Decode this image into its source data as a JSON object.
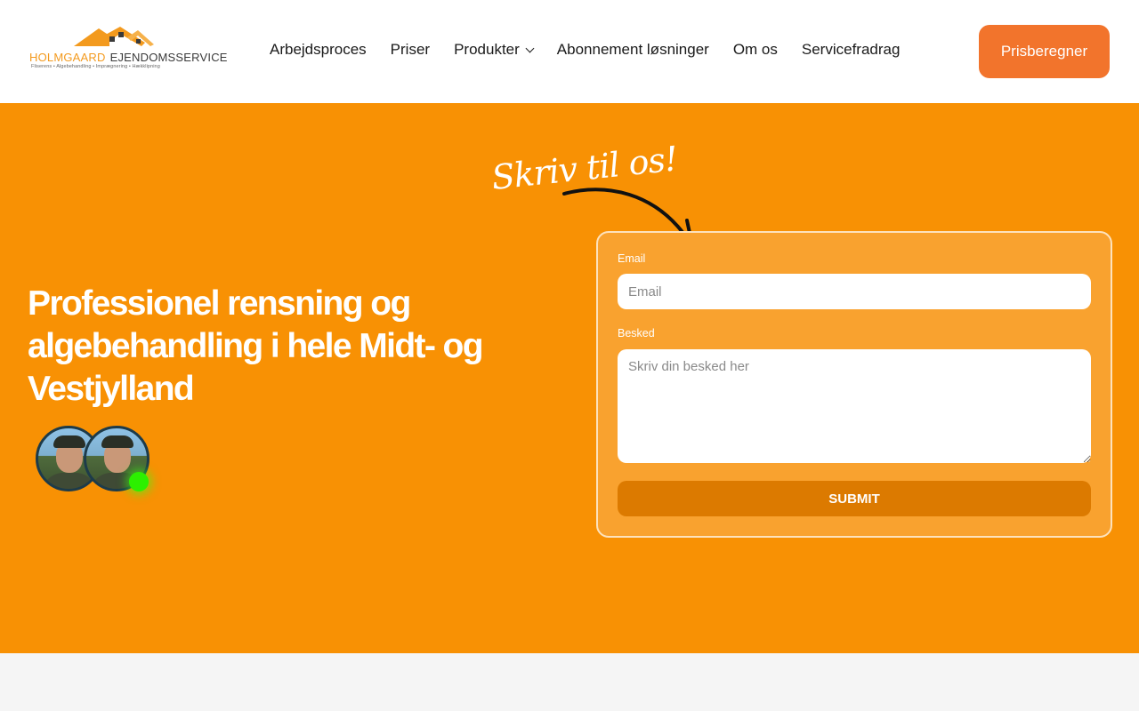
{
  "logo": {
    "name_part1": "HOLMGAARD",
    "name_part2": "EJENDOMSSERVICE",
    "tagline": "Fliserens • Algebehandling • Imprægnering • Hækklipning",
    "primary_color": "#f39a1e",
    "icon": "house-roof-logo"
  },
  "nav": {
    "items": [
      {
        "label": "Arbejdsproces"
      },
      {
        "label": "Priser"
      },
      {
        "label": "Produkter",
        "icon": "chevron-down-icon"
      },
      {
        "label": "Abonnement løsninger"
      },
      {
        "label": "Om os"
      },
      {
        "label": "Servicefradrag"
      }
    ]
  },
  "cta": {
    "label": "Prisberegner",
    "color": "#f2742c"
  },
  "hero": {
    "background": "#f89104",
    "headline": "Professionel rensning og algebehandling i hele Midt- og Vestjylland",
    "online_indicator_color": "#2cf000"
  },
  "contact": {
    "script_title": "Skriv til os!",
    "email_label": "Email",
    "email_placeholder": "Email",
    "email_value": "",
    "message_label": "Besked",
    "message_placeholder": "Skriv din besked her",
    "message_value": "",
    "submit_label": "SUBMIT",
    "submit_color": "#dc7a00"
  }
}
